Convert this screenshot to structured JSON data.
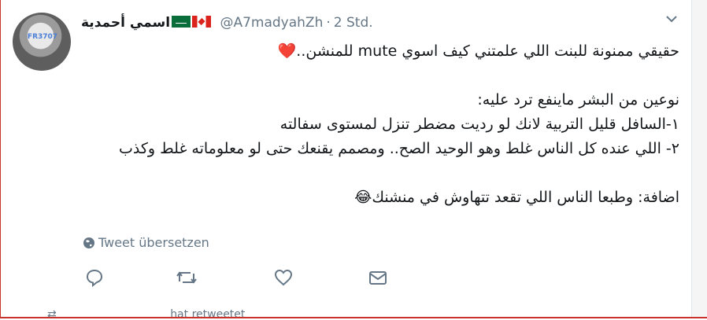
{
  "tweet": {
    "avatar_badge": "FR3707",
    "display_name": "اسمي أحمدية",
    "flags": [
      "flag-sa-icon",
      "flag-ca-icon"
    ],
    "handle": "@A7madyahZh",
    "separator": "·",
    "timestamp": "2 Std.",
    "text_lines": [
      "حقيقي ممنونة للبنت اللي علمتني كيف اسوي mute للمنشن..",
      "نوعين من البشر ماينفع ترد عليه:",
      "١-السافل قليل التربية لانك لو رديت مضطر تنزل لمستوى سفالته",
      "٢- اللي عنده كل الناس غلط وهو الوحيد الصح.. ومصمم يقنعك حتى لو معلوماته غلط وكذب",
      "اضافة: وطبعا الناس اللي تقعد تتهاوش في منشنك"
    ],
    "heart_emoji": "❤️",
    "laugh_emoji": "😂",
    "translate_label": "Tweet übersetzen",
    "actions": [
      "reply-icon",
      "retweet-icon",
      "like-icon",
      "message-icon"
    ]
  },
  "next": {
    "retweeted_label": "hat retweetet"
  },
  "colors": {
    "text": "#14171a",
    "muted": "#657786",
    "heart": "#e0245e",
    "frame": "#c8342c"
  }
}
